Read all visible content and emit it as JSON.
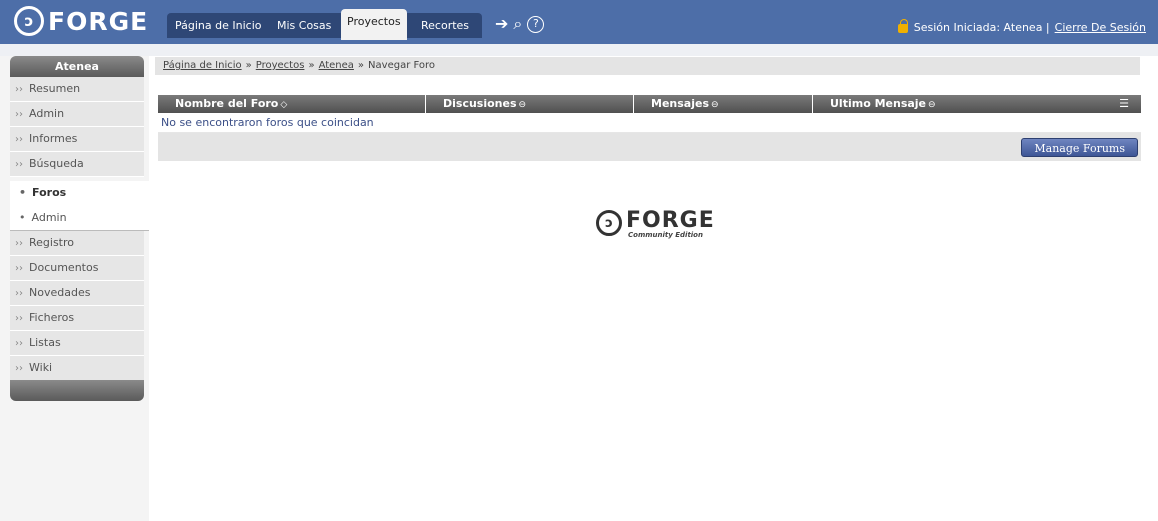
{
  "brand": {
    "logo_text": "FORGE"
  },
  "nav": {
    "tabs": [
      {
        "label": "Página de Inicio"
      },
      {
        "label": "Mis Cosas"
      },
      {
        "label": "Proyectos"
      },
      {
        "label": "Recortes"
      }
    ],
    "help_glyph": "?"
  },
  "session": {
    "text": "Sesión Iniciada: Atenea |",
    "logout": "Cierre De Sesión"
  },
  "sidebar": {
    "title": "Atenea",
    "items": [
      {
        "label": "Resumen"
      },
      {
        "label": "Admin"
      },
      {
        "label": "Informes"
      },
      {
        "label": "Búsqueda"
      }
    ],
    "sub_items": [
      {
        "label": "Foros"
      },
      {
        "label": "Admin"
      }
    ],
    "items_after": [
      {
        "label": "Registro"
      },
      {
        "label": "Documentos"
      },
      {
        "label": "Novedades"
      },
      {
        "label": "Ficheros"
      },
      {
        "label": "Listas"
      },
      {
        "label": "Wiki"
      }
    ]
  },
  "breadcrumb": {
    "items": [
      "Página de Inicio",
      "Proyectos",
      "Atenea"
    ],
    "current": "Navegar Foro",
    "separator": "»"
  },
  "table": {
    "columns": [
      "Nombre del Foro",
      "Discusiones",
      "Mensajes",
      "Ultimo Mensaje"
    ],
    "empty_message": "No se encontraron foros que coincidan",
    "manage_label": "Manage Forums"
  },
  "footer_logo": {
    "text": "FORGE",
    "subtitle": "Community Edition"
  }
}
